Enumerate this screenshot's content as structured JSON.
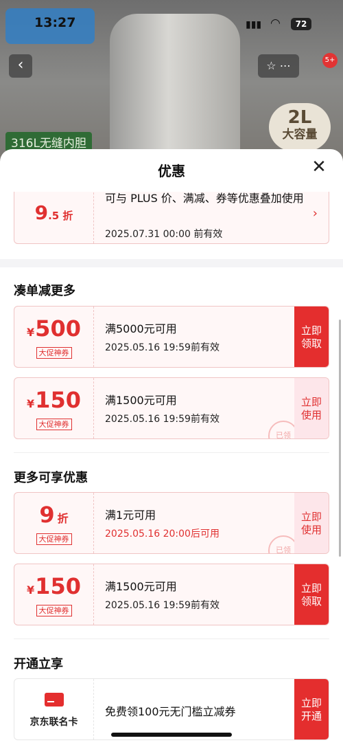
{
  "status": {
    "time": "13:27",
    "battery": "72"
  },
  "product": {
    "feature_label": "316L无缝内胆",
    "capacity_big": "2L",
    "capacity_small": "大容量",
    "cart_count": "5+"
  },
  "sheet": {
    "title": "优惠",
    "top_card": {
      "value": "9",
      "unit": ".5 折",
      "desc": "可与 PLUS 价、满减、券等优惠叠加使用",
      "date": "2025.07.31 00:00 前有效"
    },
    "section1": {
      "title": "凑单减更多",
      "coupons": [
        {
          "cur": "¥",
          "value": "500",
          "tag": "大促神券",
          "cond": "满5000元可用",
          "date": "2025.05.16 19:59前有效",
          "btn": "立即\n领取"
        },
        {
          "cur": "¥",
          "value": "150",
          "tag": "大促神券",
          "cond": "满1500元可用",
          "date": "2025.05.16 19:59前有效",
          "btn": "立即\n使用",
          "stamp": "已领"
        }
      ]
    },
    "section2": {
      "title": "更多可享优惠",
      "coupons": [
        {
          "cur": "",
          "value": "9",
          "unit": "折",
          "tag": "大促神券",
          "cond": "满1元可用",
          "date": "2025.05.16 20:00后可用",
          "btn": "立即\n使用",
          "stamp": "已领"
        },
        {
          "cur": "¥",
          "value": "150",
          "tag": "大促神券",
          "cond": "满1500元可用",
          "date": "2025.05.16 19:59前有效",
          "btn": "立即\n领取"
        }
      ]
    },
    "section3": {
      "title": "开通立享",
      "card": {
        "name": "京东联名卡",
        "desc": "免费领100元无门槛立减券",
        "btn": "立即\n开通"
      }
    }
  }
}
